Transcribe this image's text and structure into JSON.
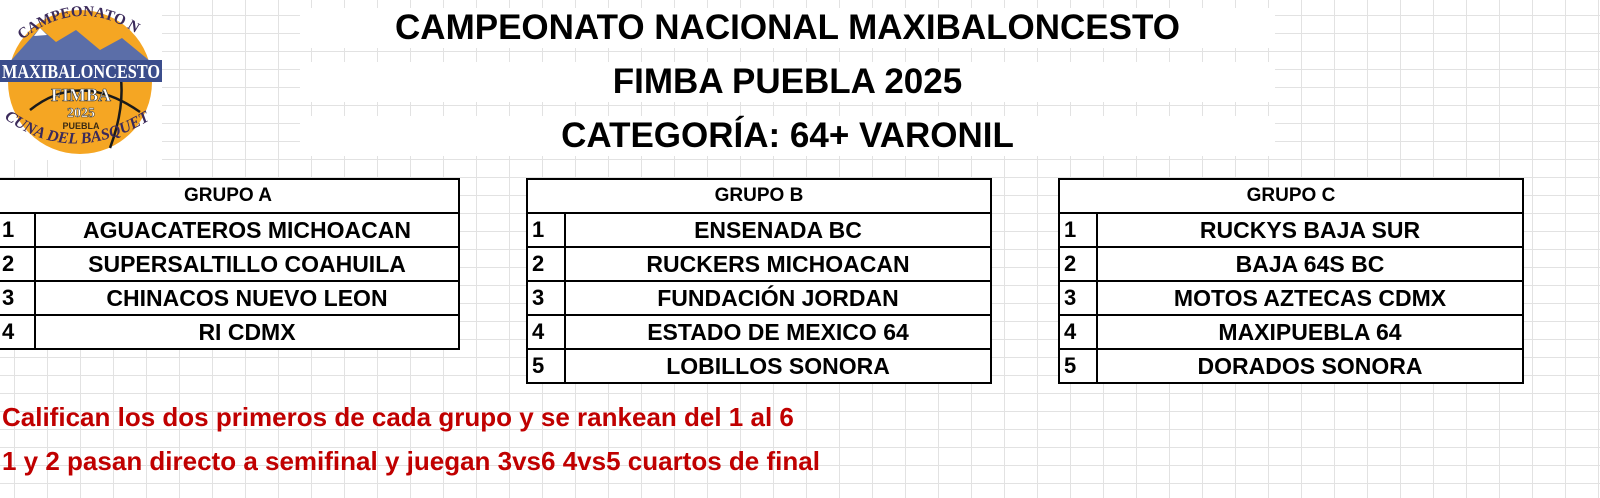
{
  "header": {
    "title_line1": "CAMPEONATO NACIONAL MAXIBALONCESTO",
    "title_line2": "FIMBA PUEBLA 2025",
    "title_line3": "CATEGORÍA:  64+ VARONIL"
  },
  "logo": {
    "arc_text": "CAMPEONATO NACIONAL",
    "banner_text": "MAXIBALONCESTO",
    "event": "FIMBA",
    "year": "2025",
    "city": "PUEBLA",
    "bottom_text": "CUNA DEL BASQUETBOL",
    "colors": {
      "ball": "#f5a623",
      "mountain": "#5b6ea8",
      "banner": "#3b4d8c"
    }
  },
  "groups": [
    {
      "name": "GRUPO A",
      "teams": [
        {
          "num": "1",
          "team": "AGUACATEROS MICHOACAN"
        },
        {
          "num": "2",
          "team": "SUPERSALTILLO COAHUILA"
        },
        {
          "num": "3",
          "team": "CHINACOS NUEVO LEON"
        },
        {
          "num": "4",
          "team": "RI CDMX"
        }
      ]
    },
    {
      "name": "GRUPO B",
      "teams": [
        {
          "num": "1",
          "team": "ENSENADA BC"
        },
        {
          "num": "2",
          "team": "RUCKERS MICHOACAN"
        },
        {
          "num": "3",
          "team": "FUNDACIÓN JORDAN"
        },
        {
          "num": "4",
          "team": "ESTADO DE MEXICO 64"
        },
        {
          "num": "5",
          "team": "LOBILLOS SONORA"
        }
      ]
    },
    {
      "name": "GRUPO C",
      "teams": [
        {
          "num": "1",
          "team": "RUCKYS BAJA SUR"
        },
        {
          "num": "2",
          "team": "BAJA 64S BC"
        },
        {
          "num": "3",
          "team": "MOTOS AZTECAS CDMX"
        },
        {
          "num": "4",
          "team": "MAXIPUEBLA 64"
        },
        {
          "num": "5",
          "team": "DORADOS SONORA"
        }
      ]
    }
  ],
  "notes": {
    "line1": "Califican los dos primeros de cada grupo y se rankean del 1 al 6",
    "line2": "1 y 2 pasan directo a semifinal y juegan 3vs6 4vs5 cuartos de final",
    "color": "#c00000"
  }
}
